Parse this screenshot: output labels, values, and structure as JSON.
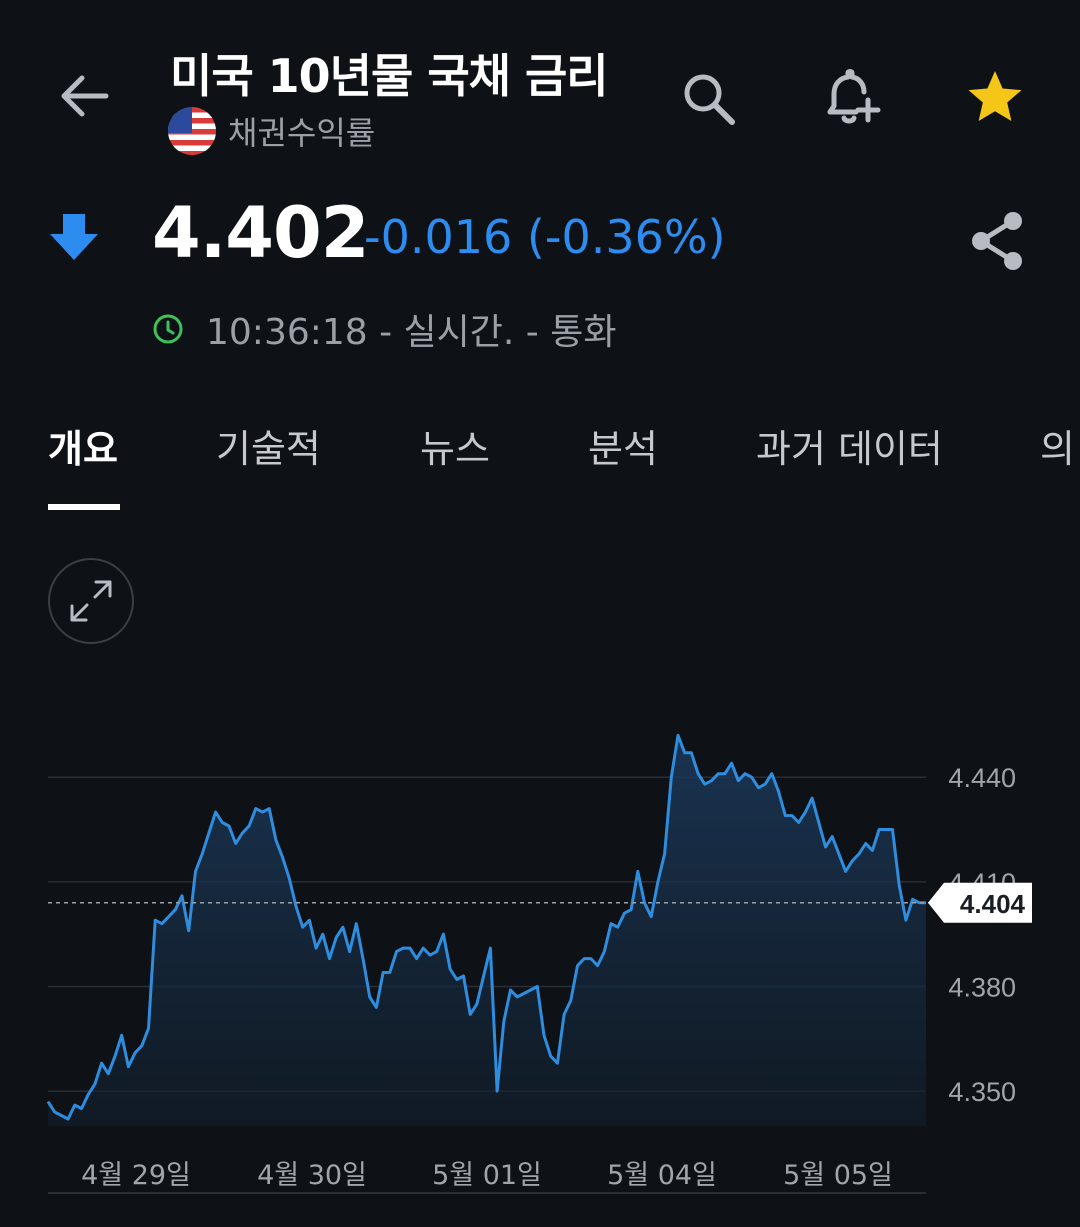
{
  "header": {
    "title": "미국 10년물 국채 금리",
    "subtitle": "채권수익률",
    "flag": "us-flag-icon"
  },
  "icons": {
    "back": "arrow-left-icon",
    "search": "search-icon",
    "alert": "bell-plus-icon",
    "favorite": "star-icon",
    "share": "share-icon",
    "trend": "arrow-down-icon",
    "clock": "clock-icon",
    "expand": "expand-icon"
  },
  "quote": {
    "price": "4.402",
    "change": "-0.016 (-0.36%)",
    "status": "10:36:18 - 실시간. - 통화"
  },
  "tabs": [
    {
      "label": "개요",
      "active": true
    },
    {
      "label": "기술적",
      "active": false
    },
    {
      "label": "뉴스",
      "active": false
    },
    {
      "label": "분석",
      "active": false
    },
    {
      "label": "과거 데이터",
      "active": false
    },
    {
      "label": "의",
      "active": false
    }
  ],
  "colors": {
    "background": "#0e1115",
    "accent_down": "#2c8cf0",
    "star": "#f5c518",
    "clock": "#3ec15a",
    "line": "#2e8ddf"
  },
  "chart_data": {
    "type": "area",
    "ylim": [
      4.34,
      4.465
    ],
    "yticks": [
      "4.440",
      "4.410",
      "4.380",
      "4.350"
    ],
    "ytick_values": [
      4.44,
      4.41,
      4.38,
      4.35
    ],
    "xticks": [
      "4월 29일",
      "4월 30일",
      "5월 01일",
      "5월 04일",
      "5월 05일"
    ],
    "current_label": "4.404",
    "current_value": 4.404,
    "grid": true,
    "x": [
      0,
      1,
      2,
      3,
      4,
      5,
      6,
      7,
      8,
      9,
      10,
      11,
      12,
      13,
      14,
      15,
      16,
      17,
      18,
      19,
      20,
      21,
      22,
      23,
      24,
      25,
      26,
      27,
      28,
      29,
      30,
      31,
      32,
      33,
      34,
      35,
      36,
      37,
      38,
      39,
      40,
      41,
      42,
      43,
      44,
      45,
      46,
      47,
      48,
      49,
      50,
      51,
      52,
      53,
      54,
      55,
      56,
      57,
      58,
      59,
      60,
      61,
      62,
      63,
      64,
      65,
      66,
      67,
      68,
      69,
      70,
      71,
      72,
      73,
      74,
      75,
      76,
      77,
      78,
      79,
      80,
      81,
      82,
      83,
      84,
      85,
      86,
      87,
      88,
      89,
      90,
      91,
      92,
      93,
      94,
      95,
      96,
      97,
      98,
      99,
      100,
      101,
      102,
      103,
      104,
      105,
      106,
      107,
      108,
      109,
      110,
      111,
      112,
      113,
      114,
      115,
      116,
      117,
      118,
      119,
      120,
      121,
      122,
      123,
      124,
      125,
      126,
      127,
      128,
      129,
      130,
      131,
      132,
      133,
      134,
      135,
      136,
      137,
      138,
      139,
      140,
      141,
      142,
      143,
      144
    ],
    "values": [
      4.347,
      4.344,
      4.343,
      4.342,
      4.346,
      4.345,
      4.349,
      4.352,
      4.358,
      4.355,
      4.36,
      4.366,
      4.357,
      4.361,
      4.363,
      4.368,
      4.399,
      4.398,
      4.4,
      4.402,
      4.406,
      4.396,
      4.413,
      4.418,
      4.424,
      4.43,
      4.427,
      4.426,
      4.421,
      4.424,
      4.426,
      4.431,
      4.43,
      4.431,
      4.422,
      4.417,
      4.411,
      4.403,
      4.397,
      4.399,
      4.391,
      4.395,
      4.388,
      4.394,
      4.397,
      4.39,
      4.398,
      4.388,
      4.377,
      4.374,
      4.384,
      4.384,
      4.39,
      4.391,
      4.391,
      4.388,
      4.391,
      4.389,
      4.39,
      4.395,
      4.385,
      4.382,
      4.383,
      4.372,
      4.375,
      4.383,
      4.391,
      4.35,
      4.37,
      4.379,
      4.377,
      4.378,
      4.379,
      4.38,
      4.366,
      4.36,
      4.358,
      4.372,
      4.376,
      4.386,
      4.388,
      4.388,
      4.386,
      4.39,
      4.398,
      4.397,
      4.401,
      4.402,
      4.413,
      4.404,
      4.4,
      4.41,
      4.418,
      4.44,
      4.452,
      4.447,
      4.447,
      4.441,
      4.438,
      4.439,
      4.441,
      4.441,
      4.444,
      4.439,
      4.441,
      4.44,
      4.437,
      4.438,
      4.441,
      4.436,
      4.429,
      4.429,
      4.427,
      4.43,
      4.434,
      4.427,
      4.42,
      4.423,
      4.418,
      4.413,
      4.416,
      4.418,
      4.421,
      4.419,
      4.425,
      4.425,
      4.425,
      4.409,
      4.399,
      4.405,
      4.404,
      4.404
    ]
  }
}
